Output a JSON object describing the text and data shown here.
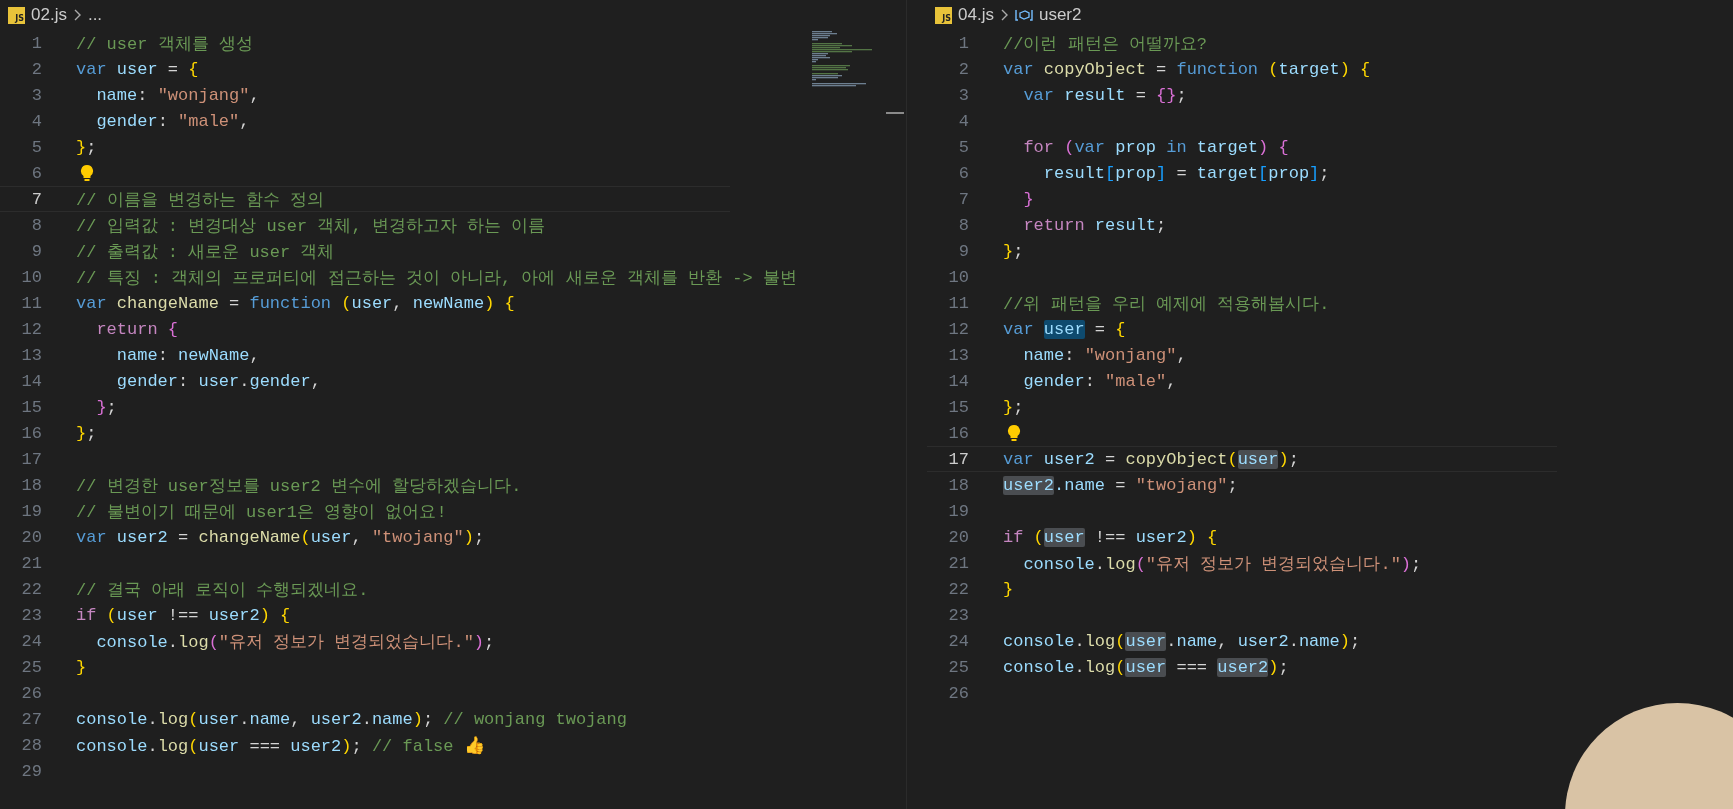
{
  "editors": [
    {
      "file_icon": "JS",
      "file": "02.js",
      "breadcrumb": "...",
      "minimap": true,
      "lines": [
        {
          "n": "1",
          "tokens": [
            {
              "text": "// user 객체를 생성",
              "color": "#6a9955"
            }
          ]
        },
        {
          "n": "2",
          "tokens": [
            {
              "text": "var ",
              "color": "#569cd6"
            },
            {
              "text": "user",
              "color": "#9cdcfe"
            },
            {
              "text": " = "
            },
            {
              "text": "{",
              "color": "#ffd700"
            }
          ]
        },
        {
          "n": "3",
          "tokens": [
            {
              "text": "  name",
              "color": "#9cdcfe"
            },
            {
              "text": ": "
            },
            {
              "text": "\"wonjang\"",
              "color": "#ce9178"
            },
            {
              "text": ","
            }
          ]
        },
        {
          "n": "4",
          "tokens": [
            {
              "text": "  gender",
              "color": "#9cdcfe"
            },
            {
              "text": ": "
            },
            {
              "text": "\"male\"",
              "color": "#ce9178"
            },
            {
              "text": ","
            }
          ]
        },
        {
          "n": "5",
          "tokens": [
            {
              "text": "}",
              "color": "#ffd700"
            },
            {
              "text": ";"
            }
          ]
        },
        {
          "n": "6",
          "bulb": true
        },
        {
          "n": "7",
          "current": true,
          "tokens": [
            {
              "text": "// 이름을 변경하는 함수 정의",
              "color": "#6a9955"
            }
          ]
        },
        {
          "n": "8",
          "tokens": [
            {
              "text": "// 입력값 : 변경대상 user 객체, 변경하고자 하는 이름",
              "color": "#6a9955"
            }
          ]
        },
        {
          "n": "9",
          "tokens": [
            {
              "text": "// 출력값 : 새로운 user 객체",
              "color": "#6a9955"
            }
          ]
        },
        {
          "n": "10",
          "tokens": [
            {
              "text": "// 특징 : 객체의 프로퍼티에 접근하는 것이 아니라, 아에 새로운 객체를 반환 -> 불변",
              "color": "#6a9955"
            }
          ]
        },
        {
          "n": "11",
          "tokens": [
            {
              "text": "var ",
              "color": "#569cd6"
            },
            {
              "text": "changeName",
              "color": "#dcdcaa"
            },
            {
              "text": " = "
            },
            {
              "text": "function ",
              "color": "#569cd6"
            },
            {
              "text": "(",
              "color": "#ffd700"
            },
            {
              "text": "user",
              "color": "#9cdcfe"
            },
            {
              "text": ", "
            },
            {
              "text": "newName",
              "color": "#9cdcfe"
            },
            {
              "text": ") ",
              "color": "#ffd700"
            },
            {
              "text": "{",
              "color": "#ffd700"
            }
          ]
        },
        {
          "n": "12",
          "tokens": [
            {
              "text": "  return ",
              "color": "#c586c0"
            },
            {
              "text": "{",
              "color": "#da70d6"
            }
          ]
        },
        {
          "n": "13",
          "tokens": [
            {
              "text": "    name",
              "color": "#9cdcfe"
            },
            {
              "text": ": "
            },
            {
              "text": "newName",
              "color": "#9cdcfe"
            },
            {
              "text": ","
            }
          ]
        },
        {
          "n": "14",
          "tokens": [
            {
              "text": "    gender",
              "color": "#9cdcfe"
            },
            {
              "text": ": "
            },
            {
              "text": "user",
              "color": "#9cdcfe"
            },
            {
              "text": "."
            },
            {
              "text": "gender",
              "color": "#9cdcfe"
            },
            {
              "text": ","
            }
          ]
        },
        {
          "n": "15",
          "tokens": [
            {
              "text": "  }",
              "color": "#da70d6"
            },
            {
              "text": ";"
            }
          ]
        },
        {
          "n": "16",
          "tokens": [
            {
              "text": "}",
              "color": "#ffd700"
            },
            {
              "text": ";"
            }
          ]
        },
        {
          "n": "17"
        },
        {
          "n": "18",
          "tokens": [
            {
              "text": "// 변경한 user정보를 user2 변수에 할당하겠습니다.",
              "color": "#6a9955"
            }
          ]
        },
        {
          "n": "19",
          "tokens": [
            {
              "text": "// 불변이기 때문에 user1은 영향이 없어요!",
              "color": "#6a9955"
            }
          ]
        },
        {
          "n": "20",
          "tokens": [
            {
              "text": "var ",
              "color": "#569cd6"
            },
            {
              "text": "user2",
              "color": "#9cdcfe"
            },
            {
              "text": " = "
            },
            {
              "text": "changeName",
              "color": "#dcdcaa"
            },
            {
              "text": "(",
              "color": "#ffd700"
            },
            {
              "text": "user",
              "color": "#9cdcfe"
            },
            {
              "text": ", "
            },
            {
              "text": "\"twojang\"",
              "color": "#ce9178"
            },
            {
              "text": ")",
              "color": "#ffd700"
            },
            {
              "text": ";"
            }
          ]
        },
        {
          "n": "21"
        },
        {
          "n": "22",
          "tokens": [
            {
              "text": "// 결국 아래 로직이 수행되겠네요.",
              "color": "#6a9955"
            }
          ]
        },
        {
          "n": "23",
          "tokens": [
            {
              "text": "if ",
              "color": "#c586c0"
            },
            {
              "text": "(",
              "color": "#ffd700"
            },
            {
              "text": "user",
              "color": "#9cdcfe"
            },
            {
              "text": " !== "
            },
            {
              "text": "user2",
              "color": "#9cdcfe"
            },
            {
              "text": ") ",
              "color": "#ffd700"
            },
            {
              "text": "{",
              "color": "#ffd700"
            }
          ]
        },
        {
          "n": "24",
          "tokens": [
            {
              "text": "  console",
              "color": "#9cdcfe"
            },
            {
              "text": "."
            },
            {
              "text": "log",
              "color": "#dcdcaa"
            },
            {
              "text": "(",
              "color": "#da70d6"
            },
            {
              "text": "\"유저 정보가 변경되었습니다.\"",
              "color": "#ce9178"
            },
            {
              "text": ")",
              "color": "#da70d6"
            },
            {
              "text": ";"
            }
          ]
        },
        {
          "n": "25",
          "tokens": [
            {
              "text": "}",
              "color": "#ffd700"
            }
          ]
        },
        {
          "n": "26"
        },
        {
          "n": "27",
          "tokens": [
            {
              "text": "console",
              "color": "#9cdcfe"
            },
            {
              "text": "."
            },
            {
              "text": "log",
              "color": "#dcdcaa"
            },
            {
              "text": "(",
              "color": "#ffd700"
            },
            {
              "text": "user",
              "color": "#9cdcfe"
            },
            {
              "text": "."
            },
            {
              "text": "name",
              "color": "#9cdcfe"
            },
            {
              "text": ", "
            },
            {
              "text": "user2",
              "color": "#9cdcfe"
            },
            {
              "text": "."
            },
            {
              "text": "name",
              "color": "#9cdcfe"
            },
            {
              "text": ")",
              "color": "#ffd700"
            },
            {
              "text": "; "
            },
            {
              "text": "// wonjang twojang",
              "color": "#6a9955"
            }
          ]
        },
        {
          "n": "28",
          "tokens": [
            {
              "text": "console",
              "color": "#9cdcfe"
            },
            {
              "text": "."
            },
            {
              "text": "log",
              "color": "#dcdcaa"
            },
            {
              "text": "(",
              "color": "#ffd700"
            },
            {
              "text": "user",
              "color": "#9cdcfe"
            },
            {
              "text": " === "
            },
            {
              "text": "user2",
              "color": "#9cdcfe"
            },
            {
              "text": ")",
              "color": "#ffd700"
            },
            {
              "text": "; "
            },
            {
              "text": "// false 👍",
              "color": "#6a9955"
            }
          ]
        },
        {
          "n": "29"
        }
      ]
    },
    {
      "file_icon": "JS",
      "file": "04.js",
      "breadcrumb": "user2",
      "symbol_icon": true,
      "lines": [
        {
          "n": "1",
          "tokens": [
            {
              "text": "//이런 패턴은 어떨까요?",
              "color": "#6a9955"
            }
          ]
        },
        {
          "n": "2",
          "tokens": [
            {
              "text": "var ",
              "color": "#569cd6"
            },
            {
              "text": "copyObject",
              "color": "#dcdcaa"
            },
            {
              "text": " = "
            },
            {
              "text": "function ",
              "color": "#569cd6"
            },
            {
              "text": "(",
              "color": "#ffd700"
            },
            {
              "text": "target",
              "color": "#9cdcfe"
            },
            {
              "text": ") ",
              "color": "#ffd700"
            },
            {
              "text": "{",
              "color": "#ffd700"
            }
          ]
        },
        {
          "n": "3",
          "tokens": [
            {
              "text": "  var ",
              "color": "#569cd6"
            },
            {
              "text": "result",
              "color": "#9cdcfe"
            },
            {
              "text": " = "
            },
            {
              "text": "{}",
              "color": "#da70d6"
            },
            {
              "text": ";"
            }
          ]
        },
        {
          "n": "4"
        },
        {
          "n": "5",
          "tokens": [
            {
              "text": "  for ",
              "color": "#c586c0"
            },
            {
              "text": "(",
              "color": "#da70d6"
            },
            {
              "text": "var ",
              "color": "#569cd6"
            },
            {
              "text": "prop ",
              "color": "#9cdcfe"
            },
            {
              "text": "in ",
              "color": "#569cd6"
            },
            {
              "text": "target",
              "color": "#9cdcfe"
            },
            {
              "text": ") ",
              "color": "#da70d6"
            },
            {
              "text": "{",
              "color": "#da70d6"
            }
          ]
        },
        {
          "n": "6",
          "tokens": [
            {
              "text": "    result",
              "color": "#9cdcfe"
            },
            {
              "text": "[",
              "color": "#179fff"
            },
            {
              "text": "prop",
              "color": "#9cdcfe"
            },
            {
              "text": "]",
              "color": "#179fff"
            },
            {
              "text": " = "
            },
            {
              "text": "target",
              "color": "#9cdcfe"
            },
            {
              "text": "[",
              "color": "#179fff"
            },
            {
              "text": "prop",
              "color": "#9cdcfe"
            },
            {
              "text": "]",
              "color": "#179fff"
            },
            {
              "text": ";"
            }
          ]
        },
        {
          "n": "7",
          "tokens": [
            {
              "text": "  }",
              "color": "#da70d6"
            }
          ]
        },
        {
          "n": "8",
          "tokens": [
            {
              "text": "  return ",
              "color": "#c586c0"
            },
            {
              "text": "result",
              "color": "#9cdcfe"
            },
            {
              "text": ";"
            }
          ]
        },
        {
          "n": "9",
          "tokens": [
            {
              "text": "}",
              "color": "#ffd700"
            },
            {
              "text": ";"
            }
          ]
        },
        {
          "n": "10"
        },
        {
          "n": "11",
          "tokens": [
            {
              "text": "//위 패턴을 우리 예제에 적용해봅시다.",
              "color": "#6a9955"
            }
          ]
        },
        {
          "n": "12",
          "tokens": [
            {
              "text": "var ",
              "color": "#569cd6"
            },
            {
              "text": "user",
              "highlighted": true,
              "write": true
            },
            {
              "text": " = "
            },
            {
              "text": "{",
              "color": "#ffd700"
            }
          ]
        },
        {
          "n": "13",
          "tokens": [
            {
              "text": "  name",
              "color": "#9cdcfe"
            },
            {
              "text": ": "
            },
            {
              "text": "\"wonjang\"",
              "color": "#ce9178"
            },
            {
              "text": ","
            }
          ]
        },
        {
          "n": "14",
          "tokens": [
            {
              "text": "  gender",
              "color": "#9cdcfe"
            },
            {
              "text": ": "
            },
            {
              "text": "\"male\"",
              "color": "#ce9178"
            },
            {
              "text": ","
            }
          ]
        },
        {
          "n": "15",
          "tokens": [
            {
              "text": "}",
              "color": "#ffd700"
            },
            {
              "text": ";"
            }
          ]
        },
        {
          "n": "16",
          "bulb": true
        },
        {
          "n": "17",
          "current": true,
          "tokens": [
            {
              "text": "var ",
              "color": "#569cd6"
            },
            {
              "text": "user2",
              "color": "#9cdcfe"
            },
            {
              "text": " = "
            },
            {
              "text": "copyObject",
              "color": "#dcdcaa"
            },
            {
              "text": "(",
              "color": "#ffd700"
            },
            {
              "text": "user",
              "highlighted": true
            },
            {
              "text": ")",
              "color": "#ffd700"
            },
            {
              "text": ";"
            }
          ]
        },
        {
          "n": "18",
          "tokens": [
            {
              "text": "user2",
              "highlighted": true
            },
            {
              "text": ".name",
              "color": "#9cdcfe"
            },
            {
              "text": " = "
            },
            {
              "text": "\"twojang\"",
              "color": "#ce9178"
            },
            {
              "text": ";"
            }
          ]
        },
        {
          "n": "19"
        },
        {
          "n": "20",
          "tokens": [
            {
              "text": "if ",
              "color": "#c586c0"
            },
            {
              "text": "(",
              "color": "#ffd700"
            },
            {
              "text": "user",
              "highlighted": true
            },
            {
              "text": " !== "
            },
            {
              "text": "user2",
              "color": "#9cdcfe"
            },
            {
              "text": ") ",
              "color": "#ffd700"
            },
            {
              "text": "{",
              "color": "#ffd700"
            }
          ]
        },
        {
          "n": "21",
          "tokens": [
            {
              "text": "  console",
              "color": "#9cdcfe"
            },
            {
              "text": "."
            },
            {
              "text": "log",
              "color": "#dcdcaa"
            },
            {
              "text": "(",
              "color": "#da70d6"
            },
            {
              "text": "\"유저 정보가 변경되었습니다.\"",
              "color": "#ce9178"
            },
            {
              "text": ")",
              "color": "#da70d6"
            },
            {
              "text": ";"
            }
          ]
        },
        {
          "n": "22",
          "tokens": [
            {
              "text": "}",
              "color": "#ffd700"
            }
          ]
        },
        {
          "n": "23"
        },
        {
          "n": "24",
          "tokens": [
            {
              "text": "console",
              "color": "#9cdcfe"
            },
            {
              "text": "."
            },
            {
              "text": "log",
              "color": "#dcdcaa"
            },
            {
              "text": "(",
              "color": "#ffd700"
            },
            {
              "text": "user",
              "highlighted": true
            },
            {
              "text": "."
            },
            {
              "text": "name",
              "color": "#9cdcfe"
            },
            {
              "text": ", "
            },
            {
              "text": "user2",
              "color": "#9cdcfe"
            },
            {
              "text": "."
            },
            {
              "text": "name",
              "color": "#9cdcfe"
            },
            {
              "text": ")",
              "color": "#ffd700"
            },
            {
              "text": ";"
            }
          ]
        },
        {
          "n": "25",
          "tokens": [
            {
              "text": "console",
              "color": "#9cdcfe"
            },
            {
              "text": "."
            },
            {
              "text": "log",
              "color": "#dcdcaa"
            },
            {
              "text": "(",
              "color": "#ffd700"
            },
            {
              "text": "user",
              "highlighted": true
            },
            {
              "text": " === "
            },
            {
              "text": "user2",
              "highlighted": true
            },
            {
              "text": ")",
              "color": "#ffd700"
            },
            {
              "text": ";"
            }
          ]
        },
        {
          "n": "26"
        }
      ]
    }
  ]
}
